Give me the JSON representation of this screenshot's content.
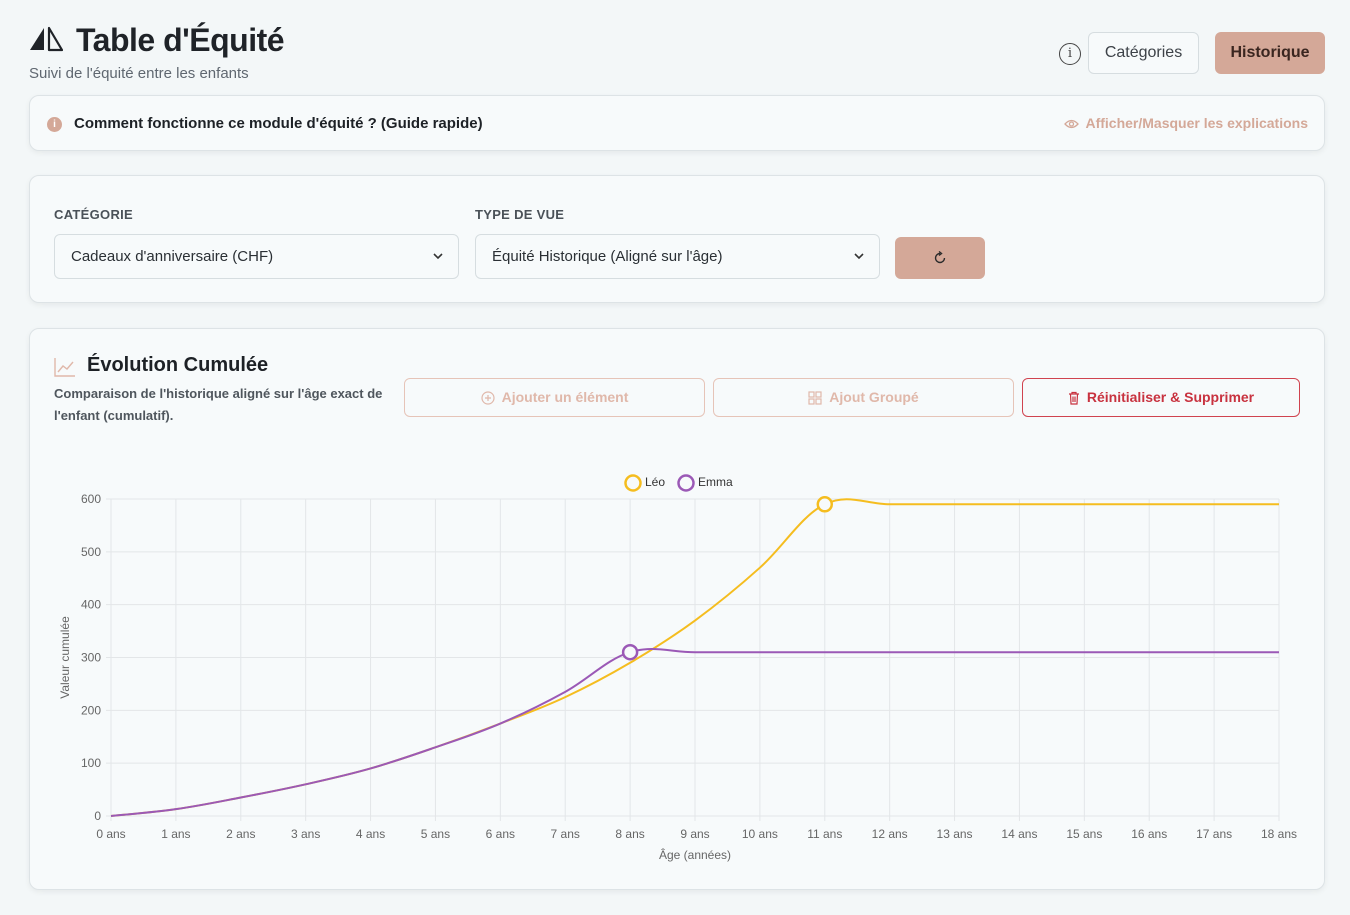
{
  "header": {
    "title": "Table d'Équité",
    "subtitle": "Suivi de l'équité entre les enfants",
    "info_glyph": "i",
    "categories_label": "Catégories",
    "history_label": "Historique"
  },
  "guide": {
    "info_glyph": "i",
    "question": "Comment fonctionne ce module d'équité ? (Guide rapide)",
    "toggle_label": "Afficher/Masquer les explications"
  },
  "filters": {
    "category_label": "CATÉGORIE",
    "category_value": "Cadeaux d'anniversaire (CHF)",
    "view_label": "TYPE DE VUE",
    "view_value": "Équité Historique (Aligné sur l'âge)"
  },
  "chart_card": {
    "title": "Évolution Cumulée",
    "description": "Comparaison de l'historique aligné sur l'âge exact de l'enfant (cumulatif).",
    "add_label": "Ajouter un élément",
    "group_label": "Ajout Groupé",
    "reset_label": "Réinitialiser & Supprimer"
  },
  "colors": {
    "accent": "#d4a898",
    "danger": "#c8323f",
    "leo": "#f5bd1f",
    "emma": "#9b59b6"
  },
  "chart_data": {
    "type": "line",
    "title": "",
    "xlabel": "Âge (années)",
    "ylabel": "Valeur cumulée",
    "x": [
      0,
      1,
      2,
      3,
      4,
      5,
      6,
      7,
      8,
      9,
      10,
      11,
      12,
      13,
      14,
      15,
      16,
      17,
      18
    ],
    "x_tick_labels": [
      "0 ans",
      "1 ans",
      "2 ans",
      "3 ans",
      "4 ans",
      "5 ans",
      "6 ans",
      "7 ans",
      "8 ans",
      "9 ans",
      "10 ans",
      "11 ans",
      "12 ans",
      "13 ans",
      "14 ans",
      "15 ans",
      "16 ans",
      "17 ans",
      "18 ans"
    ],
    "y_ticks": [
      0,
      100,
      200,
      300,
      400,
      500,
      600
    ],
    "ylim": [
      0,
      600
    ],
    "grid": true,
    "legend_position": "top-center",
    "series": [
      {
        "name": "Léo",
        "color": "#f5bd1f",
        "points": [
          [
            0,
            0
          ],
          [
            1,
            13
          ],
          [
            2,
            35
          ],
          [
            3,
            60
          ],
          [
            4,
            90
          ],
          [
            5,
            130
          ],
          [
            6,
            175
          ],
          [
            7,
            225
          ],
          [
            8,
            290
          ],
          [
            9,
            370
          ],
          [
            10,
            470
          ],
          [
            11,
            590
          ],
          [
            12,
            590
          ],
          [
            13,
            590
          ],
          [
            14,
            590
          ],
          [
            15,
            590
          ],
          [
            16,
            590
          ],
          [
            17,
            590
          ],
          [
            18,
            590
          ]
        ],
        "marker": [
          11,
          590
        ]
      },
      {
        "name": "Emma",
        "color": "#9b59b6",
        "points": [
          [
            0,
            0
          ],
          [
            1,
            13
          ],
          [
            2,
            35
          ],
          [
            3,
            60
          ],
          [
            4,
            90
          ],
          [
            5,
            130
          ],
          [
            6,
            175
          ],
          [
            7,
            235
          ],
          [
            8,
            310
          ],
          [
            9,
            310
          ],
          [
            10,
            310
          ],
          [
            11,
            310
          ],
          [
            12,
            310
          ],
          [
            13,
            310
          ],
          [
            14,
            310
          ],
          [
            15,
            310
          ],
          [
            16,
            310
          ],
          [
            17,
            310
          ],
          [
            18,
            310
          ]
        ],
        "marker": [
          8,
          310
        ]
      }
    ]
  }
}
